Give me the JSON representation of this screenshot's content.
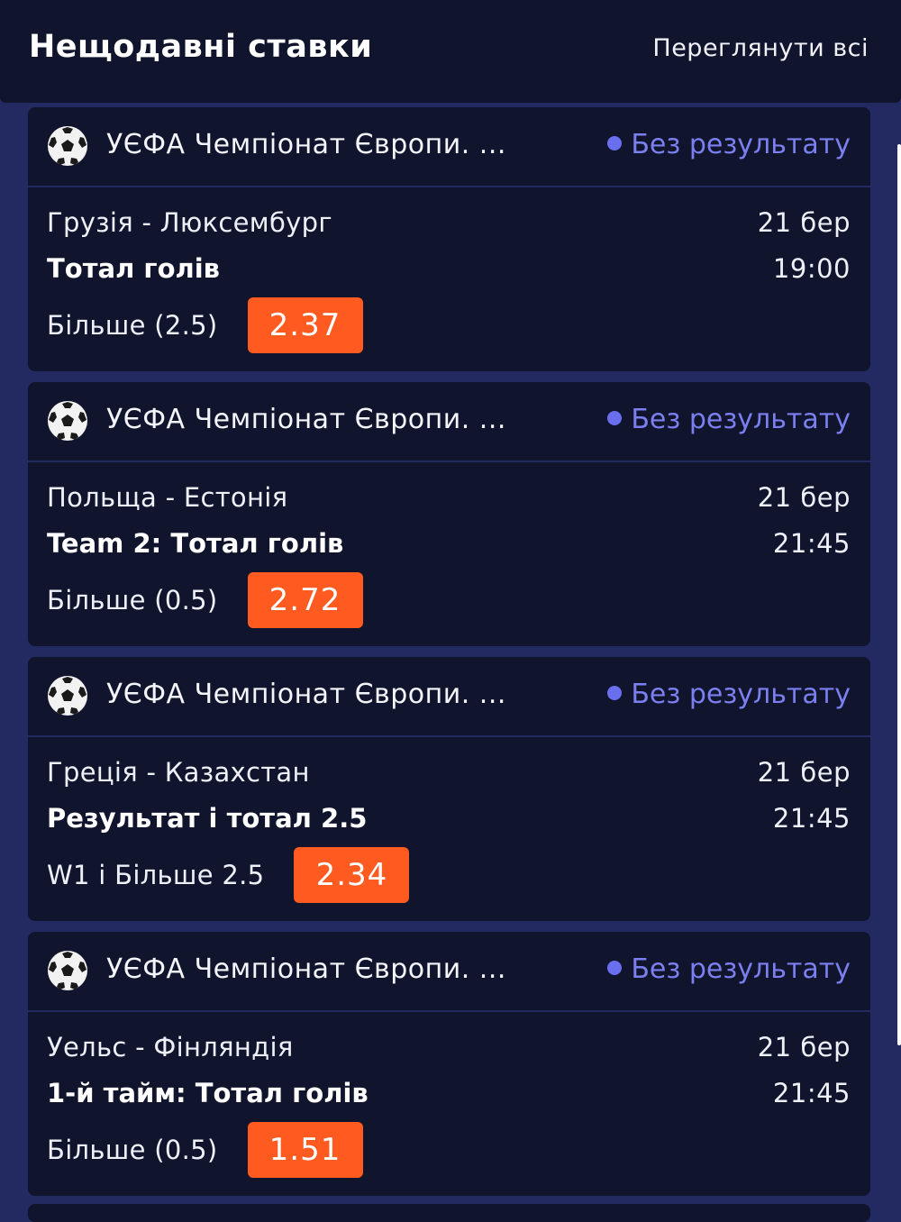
{
  "header": {
    "title": "Нещодавні ставки",
    "view_all": "Переглянути всі"
  },
  "colors": {
    "background": "#222a61",
    "card": "#10142c",
    "status": "#7b7ff0",
    "odds": "#ff5a1f"
  },
  "bets": [
    {
      "icon": "soccer-ball-icon",
      "league": "УЄФА Чемпіонат Європи. ...",
      "status": "Без результату",
      "match": "Грузія - Люксембург",
      "date": "21 бер",
      "market": "Тотал голів",
      "time": "19:00",
      "pick": "Більше (2.5)",
      "odds": "2.37"
    },
    {
      "icon": "soccer-ball-icon",
      "league": "УЄФА Чемпіонат Європи. ...",
      "status": "Без результату",
      "match": "Польща - Естонія",
      "date": "21 бер",
      "market": "Team 2: Тотал голів",
      "time": "21:45",
      "pick": "Більше (0.5)",
      "odds": "2.72"
    },
    {
      "icon": "soccer-ball-icon",
      "league": "УЄФА Чемпіонат Європи. ...",
      "status": "Без результату",
      "match": "Греція - Казахстан",
      "date": "21 бер",
      "market": "Результат і тотал 2.5",
      "time": "21:45",
      "pick": "W1 і Більше 2.5",
      "odds": "2.34"
    },
    {
      "icon": "soccer-ball-icon",
      "league": "УЄФА Чемпіонат Європи. ...",
      "status": "Без результату",
      "match": "Уельс - Фінляндія",
      "date": "21 бер",
      "market": "1-й тайм: Тотал голів",
      "time": "21:45",
      "pick": "Більше (0.5)",
      "odds": "1.51"
    }
  ]
}
